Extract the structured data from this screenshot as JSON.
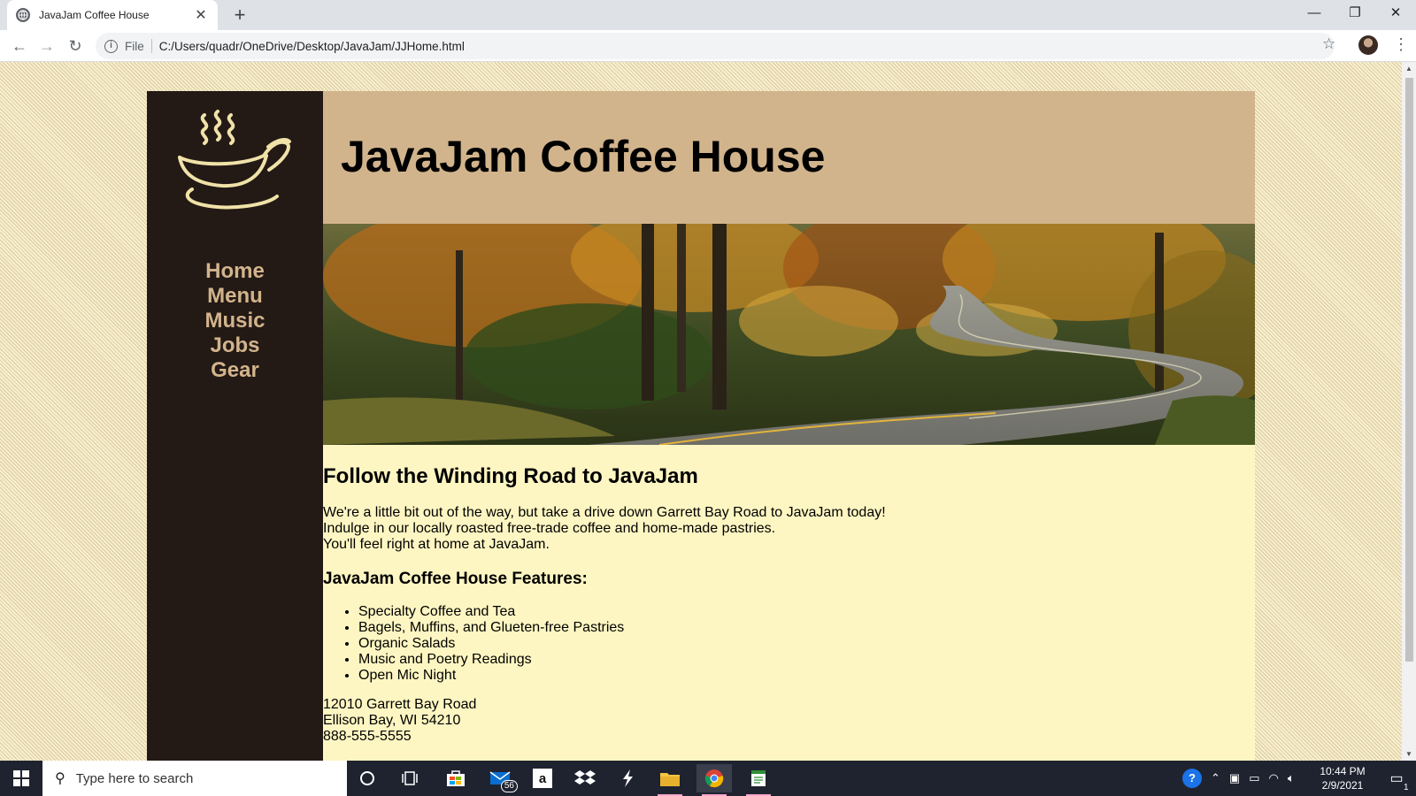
{
  "browser": {
    "tab_title": "JavaJam Coffee House",
    "tab_close": "✕",
    "new_tab": "+",
    "scheme": "File",
    "url": "C:/Users/quadr/OneDrive/Desktop/JavaJam/JJHome.html",
    "window_controls": {
      "minimize": "—",
      "restore": "❐",
      "close": "✕"
    }
  },
  "site": {
    "title": "JavaJam Coffee House",
    "nav": [
      "Home",
      "Menu",
      "Music",
      "Jobs",
      "Gear"
    ],
    "heading": "Follow the Winding Road to JavaJam",
    "intro_lines": [
      "We're a little bit out of the way, but take a drive down Garrett Bay Road to JavaJam today!",
      "Indulge in our locally roasted free-trade coffee and home-made pastries.",
      "You'll feel right at home at JavaJam."
    ],
    "features_heading": "JavaJam Coffee House Features:",
    "features": [
      "Specialty Coffee and Tea",
      "Bagels, Muffins, and Glueten-free Pastries",
      "Organic Salads",
      "Music and Poetry Readings",
      "Open Mic Night"
    ],
    "address_lines": [
      "12010 Garrett Bay Road",
      "Ellison Bay, WI 54210",
      "888-555-5555"
    ]
  },
  "taskbar": {
    "search_placeholder": "Type here to search",
    "mail_badge": "56",
    "time": "10:44 PM",
    "date": "2/9/2021",
    "notification_count": "1",
    "icons": [
      "windows-start-icon",
      "cortana-icon",
      "task-view-icon",
      "store-icon",
      "mail-icon",
      "amazon-icon",
      "dropbox-icon",
      "app-icon",
      "file-explorer-icon",
      "chrome-icon",
      "notepad-icon"
    ]
  },
  "colors": {
    "sidebar": "#231915",
    "nav_link": "#d2b48c",
    "header": "#d2b48c",
    "main_bg": "#fef6c2"
  }
}
